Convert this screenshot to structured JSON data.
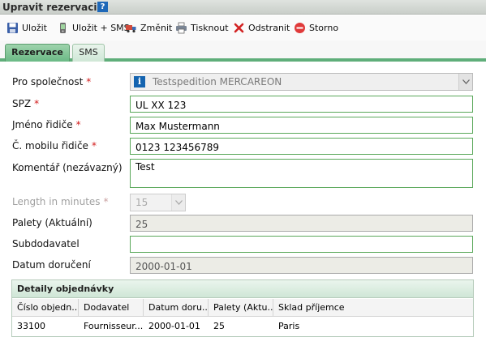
{
  "window": {
    "title": "Upravit rezervaci",
    "help": "?"
  },
  "toolbar": {
    "save": "Uložit",
    "save_sms": "Uložit + SMS",
    "change": "Změnit",
    "print": "Tisknout",
    "delete": "Odstranit",
    "cancel": "Storno"
  },
  "tabs": [
    {
      "label": "Rezervace",
      "active": true
    },
    {
      "label": "SMS",
      "active": false
    }
  ],
  "form": {
    "company_label": "Pro společnost",
    "company_value": "Testspedition MERCAREON",
    "plate_label": "SPZ",
    "plate_value": "UL XX 123",
    "driver_label": "Jméno řidiče",
    "driver_value": "Max Mustermann",
    "mobile_label": "Č. mobilu řidiče",
    "mobile_value": "0123 123456789",
    "comment_label": "Komentář (nezávazný)",
    "comment_value": "Test",
    "length_label": "Length in minutes",
    "length_value": "15",
    "pallets_label": "Palety (Aktuální)",
    "pallets_value": "25",
    "subsupplier_label": "Subdodavatel",
    "subsupplier_value": "",
    "delivery_label": "Datum doručení",
    "delivery_value": "2000-01-01",
    "required_mark": "*"
  },
  "order_details": {
    "title": "Detaily objednávky",
    "columns": [
      "Číslo objedn...",
      "Dodavatel",
      "Datum doru...",
      "Palety (Aktu...",
      "Sklad příjemce"
    ],
    "rows": [
      [
        "33100",
        "Fournisseur...",
        "2000-01-01",
        "25",
        "Paris"
      ]
    ]
  },
  "colors": {
    "accent_green": "#5fae7a",
    "required_red": "#d21919",
    "info_blue": "#1464b0"
  }
}
